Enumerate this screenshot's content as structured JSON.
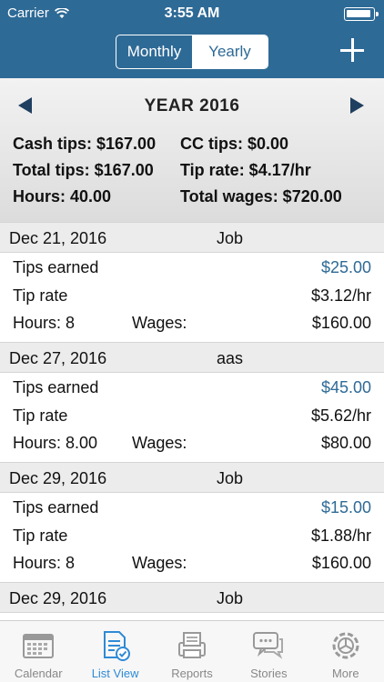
{
  "status": {
    "carrier": "Carrier",
    "time": "3:55 AM"
  },
  "nav": {
    "segments": [
      "Monthly",
      "Yearly"
    ],
    "selected": "Yearly"
  },
  "summary": {
    "title": "YEAR 2016",
    "cash_tips": "Cash tips: $167.00",
    "cc_tips": "CC tips: $0.00",
    "total_tips": "Total tips: $167.00",
    "tip_rate": "Tip rate: $4.17/hr",
    "hours": "Hours: 40.00",
    "total_wages": "Total wages: $720.00"
  },
  "labels": {
    "tips_earned": "Tips earned",
    "tip_rate": "Tip rate",
    "wages": "Wages:"
  },
  "entries": [
    {
      "date": "Dec 21, 2016",
      "job": "Job",
      "tips": "$25.00",
      "rate": "$3.12/hr",
      "hours": "Hours: 8",
      "wages": "$160.00"
    },
    {
      "date": "Dec 27, 2016",
      "job": "aas",
      "tips": "$45.00",
      "rate": "$5.62/hr",
      "hours": "Hours: 8.00",
      "wages": "$80.00"
    },
    {
      "date": "Dec 29, 2016",
      "job": "Job",
      "tips": "$15.00",
      "rate": "$1.88/hr",
      "hours": "Hours: 8",
      "wages": "$160.00"
    },
    {
      "date": "Dec 29, 2016",
      "job": "Job"
    }
  ],
  "tabs": [
    {
      "label": "Calendar",
      "icon": "calendar-icon"
    },
    {
      "label": "List View",
      "icon": "list-view-icon",
      "active": true
    },
    {
      "label": "Reports",
      "icon": "reports-icon"
    },
    {
      "label": "Stories",
      "icon": "stories-icon"
    },
    {
      "label": "More",
      "icon": "more-icon"
    }
  ],
  "colors": {
    "nav_bg": "#2e6a96",
    "accent": "#2e8ad6",
    "tips_blue": "#2e6a96"
  }
}
